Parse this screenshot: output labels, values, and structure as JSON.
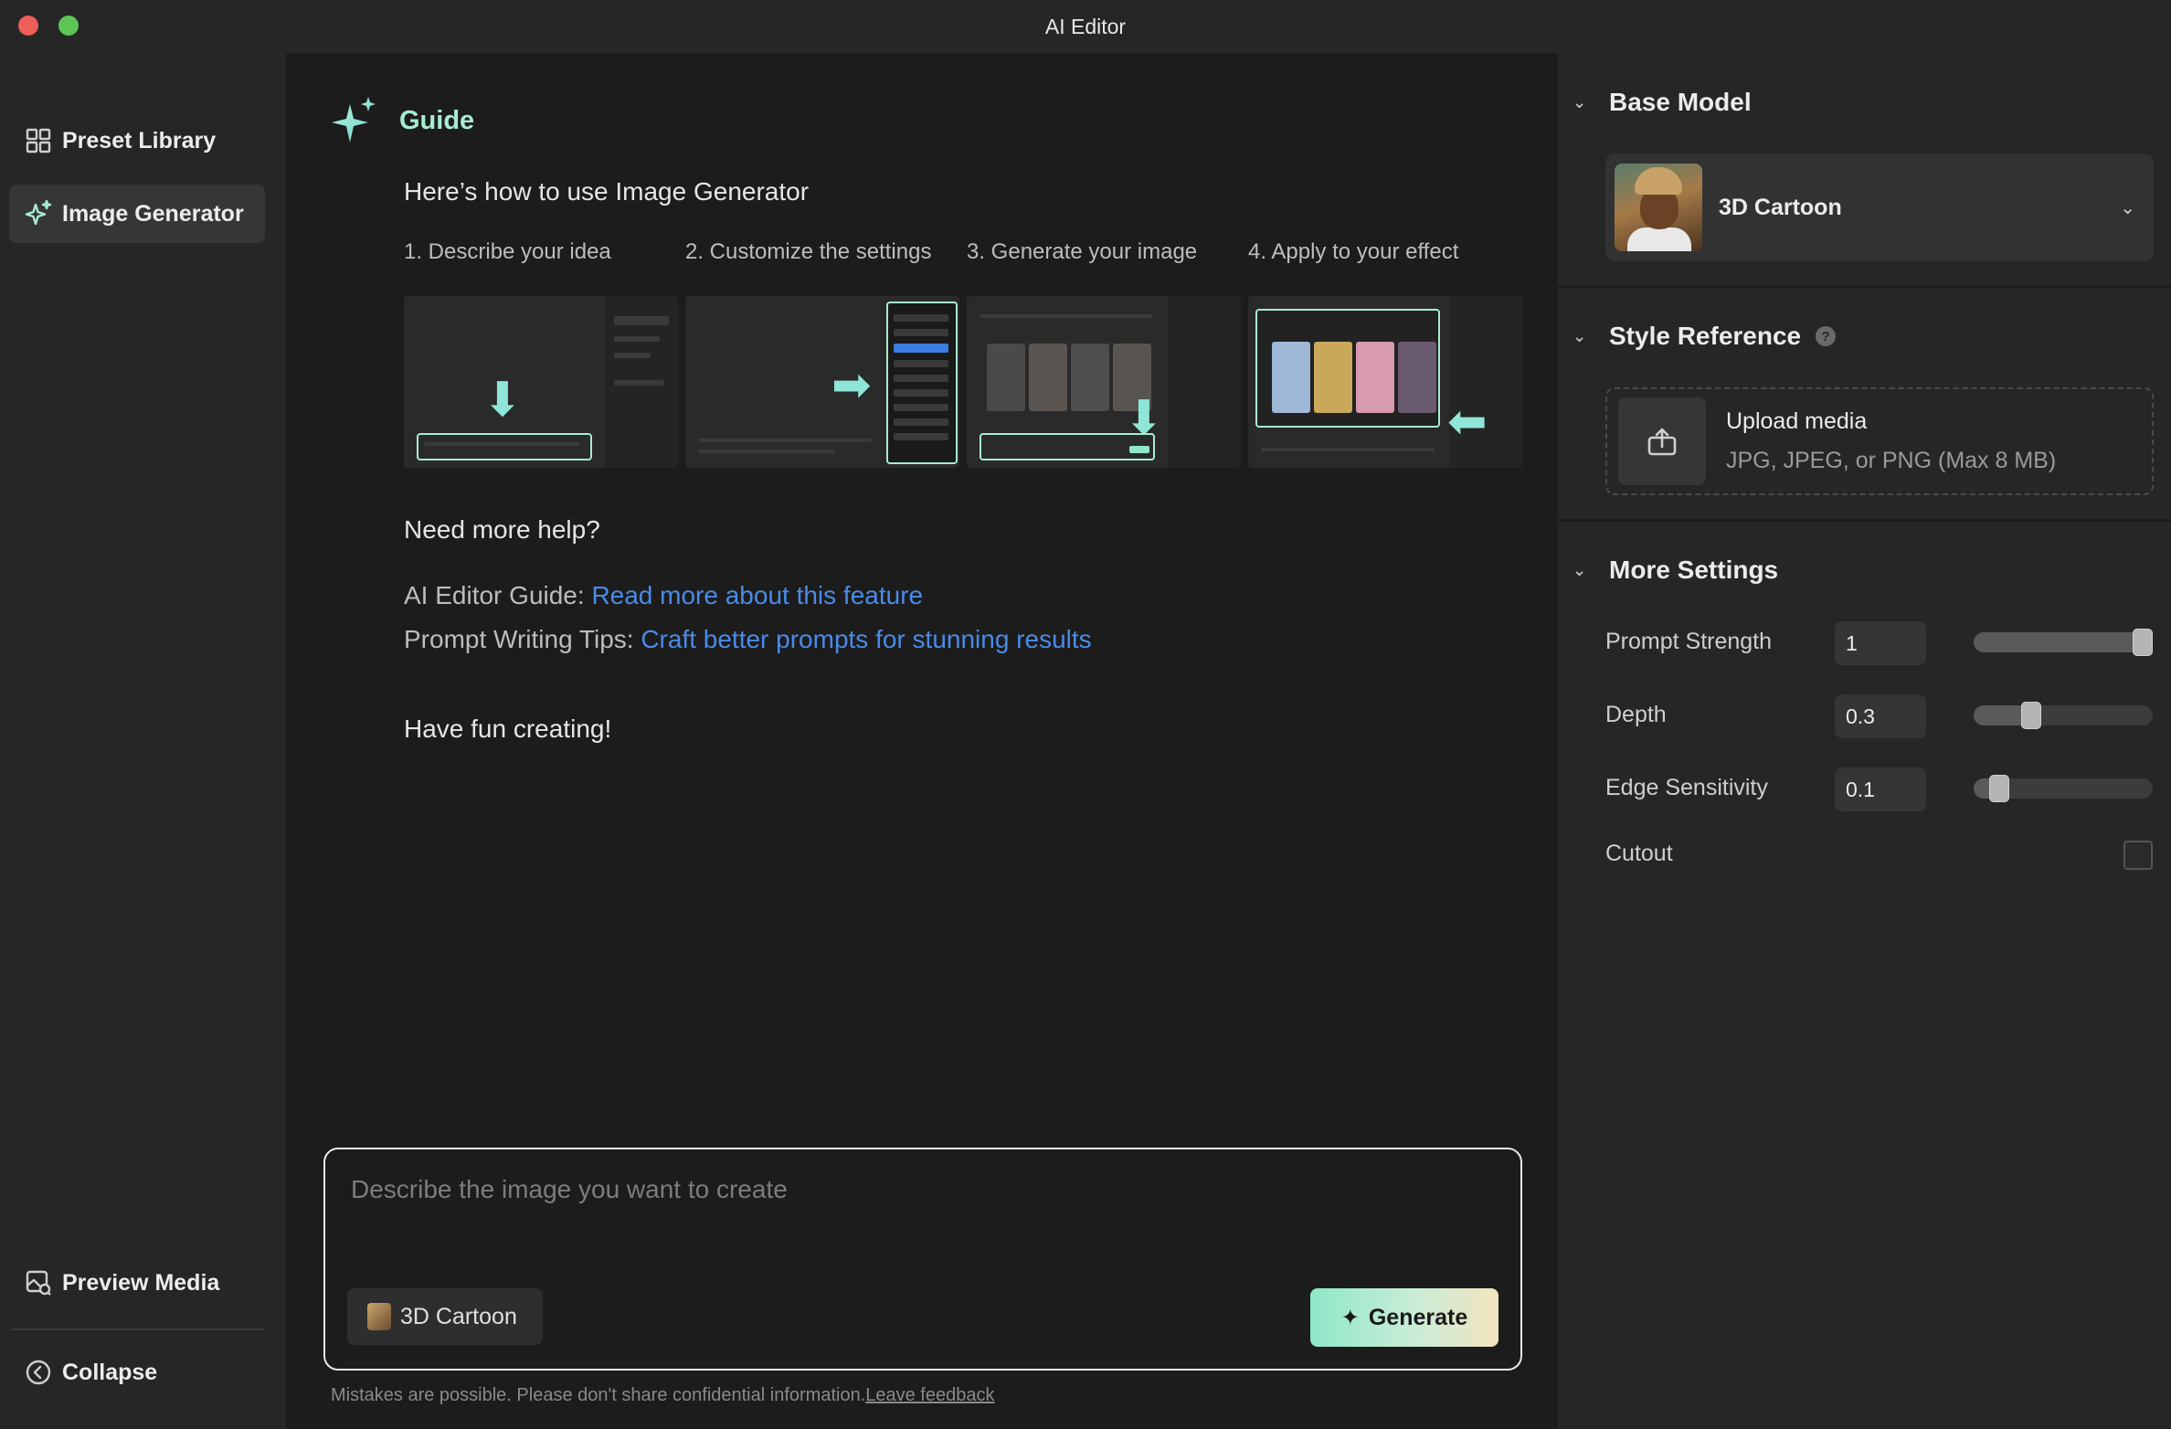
{
  "window": {
    "title": "AI Editor"
  },
  "sidebar": {
    "items": [
      {
        "label": "Preset Library",
        "icon": "grid-icon"
      },
      {
        "label": "Image Generator",
        "icon": "sparkle-icon",
        "active": true
      }
    ],
    "bottom": [
      {
        "label": "Preview Media",
        "icon": "preview-media-icon"
      },
      {
        "label": "Collapse",
        "icon": "chevron-left-circle-icon"
      }
    ]
  },
  "guide": {
    "title": "Guide",
    "intro": "Here’s how to use Image Generator",
    "steps": [
      "1. Describe your idea",
      "2. Customize the settings",
      "3. Generate your image",
      "4. Apply to your effect"
    ],
    "help_heading": "Need more help?",
    "links": [
      {
        "prefix": "AI Editor Guide: ",
        "text": "Read more about this feature"
      },
      {
        "prefix": "Prompt Writing Tips: ",
        "text": "Craft better prompts for stunning results"
      }
    ],
    "closing": "Have fun creating!"
  },
  "prompt": {
    "placeholder": "Describe the image you want to create",
    "chip_label": "3D Cartoon",
    "generate_label": "Generate",
    "disclaimer": "Mistakes are possible. Please don't share confidential information.",
    "feedback_label": "Leave feedback"
  },
  "right_panel": {
    "base_model": {
      "heading": "Base Model",
      "selected": "3D Cartoon"
    },
    "style_reference": {
      "heading": "Style Reference",
      "help_icon": "?",
      "upload_title": "Upload media",
      "upload_hint": "JPG, JPEG, or PNG (Max 8 MB)"
    },
    "more_settings": {
      "heading": "More Settings",
      "settings": [
        {
          "label": "Prompt Strength",
          "value": "1",
          "fraction": 1.0
        },
        {
          "label": "Depth",
          "value": "0.3",
          "fraction": 0.3
        },
        {
          "label": "Edge Sensitivity",
          "value": "0.1",
          "fraction": 0.1
        }
      ],
      "cutout_label": "Cutout",
      "cutout_checked": false
    }
  },
  "colors": {
    "accent_mint": "#a8ecd0",
    "link_blue": "#4a8be8",
    "traffic_red": "#ee5f57",
    "traffic_green": "#5ec456"
  }
}
